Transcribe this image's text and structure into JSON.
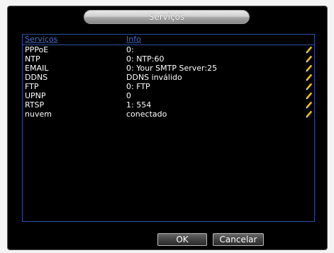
{
  "dialog": {
    "title": "Serviços"
  },
  "table": {
    "columns": [
      "Serviços",
      "Info"
    ],
    "rows": [
      {
        "name": "PPPoE",
        "info": "0:"
      },
      {
        "name": "NTP",
        "info": "0: NTP:60"
      },
      {
        "name": "EMAIL",
        "info": "0: Your SMTP Server:25"
      },
      {
        "name": "DDNS",
        "info": "DDNS inválido"
      },
      {
        "name": "FTP",
        "info": "0: FTP"
      },
      {
        "name": "UPNP",
        "info": "0"
      },
      {
        "name": "RTSP",
        "info": "1: 554"
      },
      {
        "name": "nuvem",
        "info": "conectado"
      }
    ],
    "row_action_icon": "edit-pencil-icon"
  },
  "buttons": {
    "ok_label": "OK",
    "cancel_label": "Cancelar"
  },
  "colors": {
    "header_text": "#4a6fd1",
    "border_blue": "#2a53a5",
    "edit_icon": "#f2c200"
  }
}
